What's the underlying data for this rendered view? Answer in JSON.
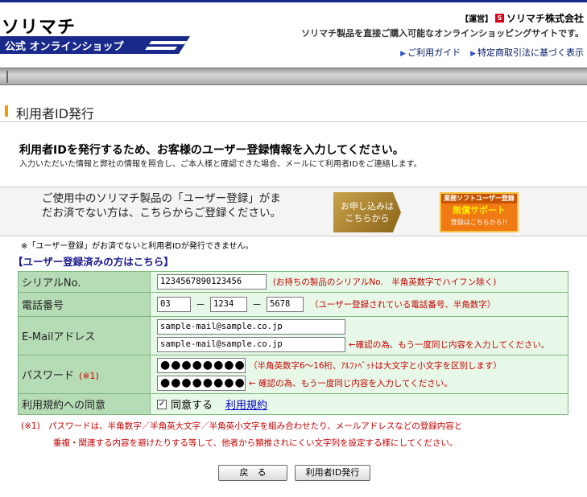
{
  "header": {
    "logo_main": "ソリマチ",
    "logo_sub": "公式 オンラインショップ",
    "operator_tag": "【運営】",
    "operator_name": "ソリマチ株式会社",
    "tagline": "ソリマチ製品を直接ご購入可能なオンラインショッピングサイトです。",
    "links": [
      "ご利用ガイド",
      "特定商取引法に基づく表示"
    ]
  },
  "page": {
    "title": "利用者ID発行",
    "lead": "利用者IDを発行するため、お客様のユーザー登録情報を入力してください。",
    "lead_sub": "入力いただいた情報と弊社の情報を照合し、ご本人様と確認できた場合、メールにて利用者IDをご連絡します。"
  },
  "registration": {
    "text": "ご使用中のソリマチ製品の「ユーザー登録」がまだお済でない方は、こちらからご登録ください。",
    "apply_line1": "お申し込みは",
    "apply_line2": "こちらから",
    "support_line1": "業務ソフトユーザー登録",
    "support_line2": "無償サポート",
    "support_line3": "登録はこちらから!!",
    "note": "※「ユーザー登録」がお済でないと利用者IDが発行できません。"
  },
  "form": {
    "section_title": "【ユーザー登録済みの方はこちら】",
    "serial_label": "シリアルNo.",
    "serial_value": "1234567890123456",
    "serial_hint": "(お持ちの製品のシリアルNo.　半角英数字でハイフン除く)",
    "phone_label": "電話番号",
    "phone1": "03",
    "phone2": "1234",
    "phone3": "5678",
    "phone_dash": "－",
    "phone_hint": "（ユーザー登録されている電話番号、半角数字）",
    "email_label": "E-Mailアドレス",
    "email_value": "sample-mail@sample.co.jp",
    "email_confirm_value": "sample-mail@sample.co.jp",
    "email_hint": "←確認の為、もう一度同じ内容を入力してください。",
    "password_label": "パスワード",
    "password_mark": "(※1)",
    "password_mask": "●●●●●●●●",
    "password_hint": "（半角英数字6～16桁、ｱﾙﾌｧﾍﾞｯﾄは大文字と小文字を区別します）",
    "password_confirm_hint": "← 確認の為、もう一度同じ内容を入力してください。",
    "terms_label": "利用規約への同意",
    "agree_checked": true,
    "agree_check_glyph": "✓",
    "agree_label": "同意する",
    "terms_link": "利用規約"
  },
  "footnote": {
    "line1": "(※1)　パスワードは、半角数字／半角英大文字／半角英小文字を組み合わせたり、メールアドレスなどの登録内容と",
    "line2": "重複・関連する内容を避けたりする等して、他者から類推されにくい文字列を設定する様にしてください。"
  },
  "buttons": {
    "back": "戻　る",
    "issue": "利用者ID発行"
  },
  "colors": {
    "brand_navy": "#1a2a8c",
    "accent_orange": "#f19a00",
    "form_label_bg": "#b6dcb6",
    "form_value_bg": "#e8f8e8",
    "hint_red": "#c40000"
  }
}
